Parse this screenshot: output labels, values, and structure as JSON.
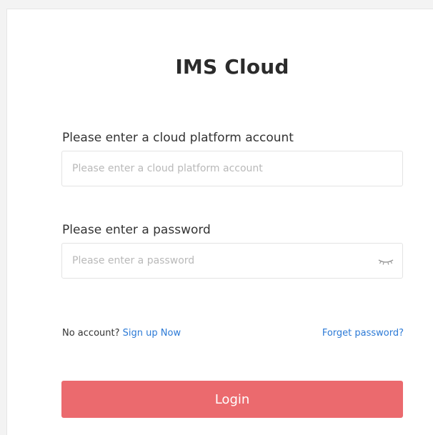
{
  "app": {
    "title": "IMS Cloud"
  },
  "form": {
    "account": {
      "label": "Please enter a cloud platform account",
      "placeholder": "Please enter a cloud platform account",
      "value": ""
    },
    "password": {
      "label": "Please enter a password",
      "placeholder": "Please enter a password",
      "value": "",
      "toggle_icon": "eye-closed-icon"
    }
  },
  "links": {
    "no_account_text": "No account?",
    "signup_label": "Sign up Now",
    "forget_label": "Forget password?"
  },
  "actions": {
    "login_label": "Login"
  },
  "colors": {
    "accent_button": "#eb6a6e",
    "link": "#2c7ad6"
  }
}
